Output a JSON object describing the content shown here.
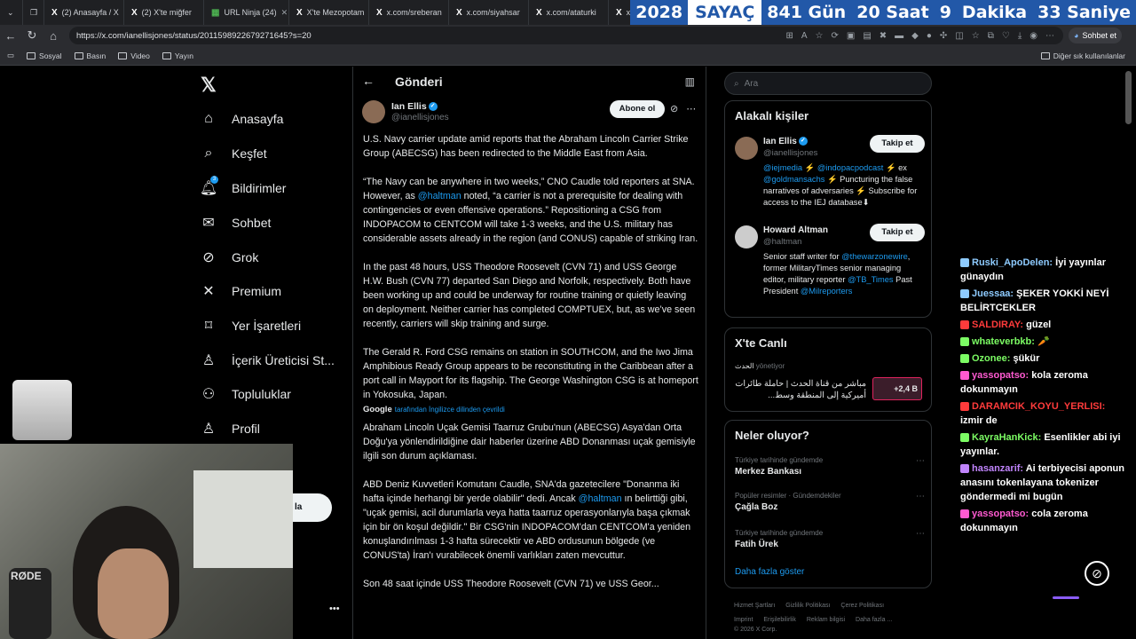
{
  "tabs": [
    {
      "label": "(2) Anasayfa / X"
    },
    {
      "label": "(2) X'te miğfer"
    },
    {
      "label": "URL Ninja (24)"
    },
    {
      "label": "X'te Mezopotam"
    },
    {
      "label": "x.com/sreberan"
    },
    {
      "label": "x.com/siyahsar"
    },
    {
      "label": "x.com/ataturki"
    },
    {
      "label": "x.com/"
    }
  ],
  "counter": {
    "year": "2028",
    "label": "SAYAÇ",
    "days": "841 Gün",
    "hours": "20 Saat",
    "minutes_value": "9",
    "minutes_label": "Dakika",
    "seconds": "33 Saniye"
  },
  "address": {
    "url": "https://x.com/ianellisjones/status/2011598922679271645?s=20"
  },
  "chat_pill": "Sohbet et",
  "bookmarks": [
    "Sosyal",
    "Basın",
    "Video",
    "Yayın"
  ],
  "other_bookmarks": "Diğer sık kullanılanlar",
  "nav": {
    "items": [
      {
        "label": "Anasayfa",
        "icon": "home-icon"
      },
      {
        "label": "Keşfet",
        "icon": "search-icon"
      },
      {
        "label": "Bildirimler",
        "icon": "bell-icon",
        "badge": "3"
      },
      {
        "label": "Sohbet",
        "icon": "mail-icon"
      },
      {
        "label": "Grok",
        "icon": "grok-icon"
      },
      {
        "label": "Premium",
        "icon": "x-logo-icon"
      },
      {
        "label": "Yer İşaretleri",
        "icon": "bookmark-icon"
      },
      {
        "label": "İçerik Üreticisi St...",
        "icon": "creator-icon"
      },
      {
        "label": "Topluluklar",
        "icon": "people-icon"
      },
      {
        "label": "Profil",
        "icon": "person-icon"
      }
    ],
    "post_button_tail": "la"
  },
  "main": {
    "title": "Gönderi",
    "author_name": "Ian Ellis",
    "author_handle": "@ianellisjones",
    "subscribe_label": "Abone ol",
    "tweet_paragraphs": [
      "U.S. Navy carrier update amid reports that the Abraham Lincoln Carrier Strike Group (ABECSG) has been redirected to the Middle East from Asia.",
      "“The Navy can be anywhere in two weeks,” CNO Caudle told reporters at SNA. However, as @haltman noted, “a carrier is not a prerequisite for dealing with contingencies or even offensive operations.” Repositioning a CSG from INDOPACOM to CENTCOM will take 1-3 weeks, and the U.S. military has considerable assets already in the region (and CONUS) capable of striking Iran.",
      "In the past 48 hours, USS Theodore Roosevelt (CVN 71) and USS George H.W. Bush (CVN 77) departed San Diego and Norfolk, respectively. Both have been working up and could be underway for routine training or quietly leaving on deployment. Neither carrier has completed COMPTUEX, but, as we’ve seen recently, carriers will skip training and surge.",
      "The Gerald R. Ford CSG remains on station in SOUTHCOM, and the Iwo Jima Amphibious Ready Group appears to be reconstituting in the Caribbean after a port call in Mayport for its flagship. The George Washington CSG is at homeport in Yokosuka, Japan."
    ],
    "translate_brand": "Google",
    "translate_note": "tarafından İngilizce dilinden çevrildi",
    "translated_paragraphs": [
      "Abraham Lincoln Uçak Gemisi Taarruz Grubu'nun (ABECSG) Asya'dan Orta Doğu'ya yönlendirildiğine dair haberler üzerine ABD Donanması uçak gemisiyle ilgili son durum açıklaması.",
      "ABD Deniz Kuvvetleri Komutanı Caudle, SNA'da gazetecilere \"Donanma iki hafta içinde herhangi bir yerde olabilir\" dedi. Ancak @haltman ın belirttiği gibi, \"uçak gemisi, acil durumlarla veya hatta taarruz operasyonlarıyla başa çıkmak için bir ön koşul değildir.\" Bir CSG'nin INDOPACOM'dan CENTCOM'a yeniden konuşlandırılması 1-3 hafta sürecektir ve ABD ordusunun bölgede (ve CONUS'ta) İran'ı vurabilecek önemli varlıkları zaten mevcuttur.",
      "Son 48 saat içinde USS Theodore Roosevelt (CVN 71) ve USS Geor..."
    ]
  },
  "right": {
    "search_placeholder": "Ara",
    "related_title": "Alakalı kişiler",
    "people": [
      {
        "name": "Ian Ellis",
        "handle": "@ianellisjones",
        "follow": "Takip et",
        "bio": "@iejmedia ⚡ @indopacpodcast ⚡ ex @goldmansachs ⚡ Puncturing the false narratives of adversaries ⚡ Subscribe for access to the IEJ database⬇"
      },
      {
        "name": "Howard Altman",
        "handle": "@haltman",
        "follow": "Takip et",
        "bio": "Senior staff writer for @thewarzonewire, former MilitaryTimes senior managing editor, military reporter @TB_Times Past President @Milreporters"
      }
    ],
    "live_title": "X'te Canlı",
    "live_channel": "الحدث",
    "live_role": "yönetiyor",
    "live_text": "مباشر من قناة الحدث | حاملة طائرات أميركية إلى المنطقة وسط...",
    "live_count": "+2,4 B",
    "trends_title": "Neler oluyor?",
    "trends": [
      {
        "context": "Türkiye tarihinde gündemde",
        "title": "Merkez Bankası"
      },
      {
        "context": "Popüler resimler · Gündemdekiler",
        "title": "Çağla Boz"
      },
      {
        "context": "Türkiye tarihinde gündemde",
        "title": "Fatih Ürek"
      }
    ],
    "show_more": "Daha fazla göster",
    "footer": [
      "Hizmet Şartları",
      "Gizlilik Politikası",
      "Çerez Politikası",
      "Imprint",
      "Erişilebilirlik",
      "Reklam bilgisi",
      "Daha fazla ...",
      "© 2026 X Corp."
    ]
  },
  "chat": [
    {
      "user": "Ruski_ApoDelen:",
      "text": "İyi yayınlar günaydın",
      "color": "#8ecbff"
    },
    {
      "user": "Juessaa:",
      "text": "ŞEKER YOKKİ NEYİ BELİRTCEKLER",
      "color": "#8ecbff"
    },
    {
      "user": "SALDIRAY:",
      "text": "güzel",
      "color": "#ff3b3b"
    },
    {
      "user": "whateverbkb:",
      "text": "🥕",
      "color": "#7cfc64"
    },
    {
      "user": "Ozonee:",
      "text": "şükür",
      "color": "#7cfc64"
    },
    {
      "user": "yassopatso:",
      "text": "kola zeroma dokunmayın",
      "color": "#ff5ad1"
    },
    {
      "user": "DARAMCIK_KOYU_YERLISI:",
      "text": "izmir de",
      "color": "#ff3b3b"
    },
    {
      "user": "KayraHanKick:",
      "text": "Esenlikler abi iyi yayınlar.",
      "color": "#7cfc64"
    },
    {
      "user": "hasanzarif:",
      "text": "Ai terbiyecisi aponun anasını tokenlayana tokenizer göndermedi mi bugün",
      "color": "#c084fc"
    },
    {
      "user": "yassopatso:",
      "text": "cola zeroma dokunmayın",
      "color": "#ff5ad1"
    }
  ],
  "webcam_brand": "RØDE"
}
